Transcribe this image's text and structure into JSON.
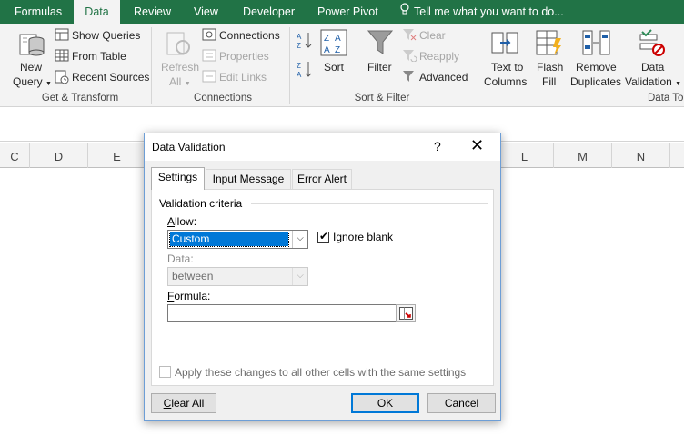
{
  "ribbon_tabs": [
    {
      "label": "Formulas",
      "active": false
    },
    {
      "label": "Data",
      "active": true
    },
    {
      "label": "Review",
      "active": false
    },
    {
      "label": "View",
      "active": false
    },
    {
      "label": "Developer",
      "active": false
    },
    {
      "label": "Power Pivot",
      "active": false
    }
  ],
  "tell_me": "Tell me what you want to do...",
  "ribbon": {
    "new_query_1": "New",
    "new_query_2": "Query",
    "show_queries": "Show Queries",
    "from_table": "From Table",
    "recent_sources": "Recent Sources",
    "group_get_transform": "Get & Transform",
    "refresh_1": "Refresh",
    "refresh_2": "All",
    "connections": "Connections",
    "properties": "Properties",
    "edit_links": "Edit Links",
    "group_connections": "Connections",
    "sort": "Sort",
    "filter": "Filter",
    "clear": "Clear",
    "reapply": "Reapply",
    "advanced": "Advanced",
    "group_sort_filter": "Sort & Filter",
    "text_to_columns_1": "Text to",
    "text_to_columns_2": "Columns",
    "flash_fill_1": "Flash",
    "flash_fill_2": "Fill",
    "remove_dup_1": "Remove",
    "remove_dup_2": "Duplicates",
    "data_validation_1": "Data",
    "data_validation_2": "Validation",
    "group_data_tools": "Data To"
  },
  "columns": [
    "C",
    "D",
    "E",
    "",
    "",
    "",
    "",
    "",
    "L",
    "M",
    "N"
  ],
  "dialog": {
    "title": "Data Validation",
    "help": "?",
    "close": "✕",
    "tabs": [
      "Settings",
      "Input Message",
      "Error Alert"
    ],
    "section_title": "Validation criteria",
    "allow_label_pre": "",
    "allow_label_u": "A",
    "allow_label_post": "llow:",
    "allow_value": "Custom",
    "ignore_blank_pre": "Ignore ",
    "ignore_blank_u": "b",
    "ignore_blank_post": "lank",
    "ignore_blank_checked": true,
    "data_label": "Data:",
    "data_value": "between",
    "formula_label_u": "F",
    "formula_label_post": "ormula:",
    "formula_value": "",
    "apply_all_label": "Apply these changes to all other cells with the same settings",
    "apply_all_checked": false,
    "clear_all_u": "C",
    "clear_all_post": "lear All",
    "ok": "OK",
    "cancel": "Cancel"
  },
  "colors": {
    "excel_green": "#217346",
    "selection_blue": "#0078d7"
  }
}
